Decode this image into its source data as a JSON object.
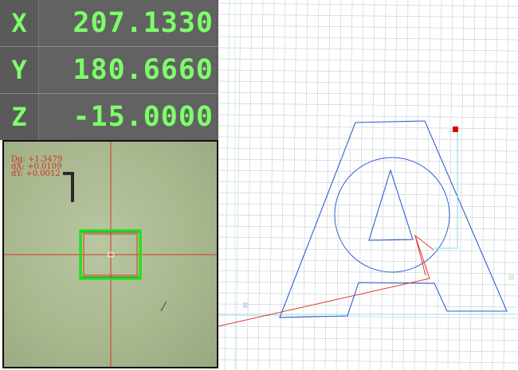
{
  "dro": {
    "rows": [
      {
        "axis": "X",
        "value": "207.1330"
      },
      {
        "axis": "Y",
        "value": "180.6660"
      },
      {
        "axis": "Z",
        "value": "-15.0000"
      }
    ],
    "text_color": "#7dff6a"
  },
  "camera": {
    "readout": {
      "dg": "Dg: +1.3479",
      "dx": "dX: +0.0109",
      "dy": "dY: +0.0012"
    },
    "crosshair_color": "#d9381e",
    "target_box_color": "#22e01a"
  },
  "canvas": {
    "grid_color": "#cfd3d8",
    "shape_color": "#2f5fd0",
    "path_color": "#e03a2a",
    "marker_color": "#e00000"
  }
}
